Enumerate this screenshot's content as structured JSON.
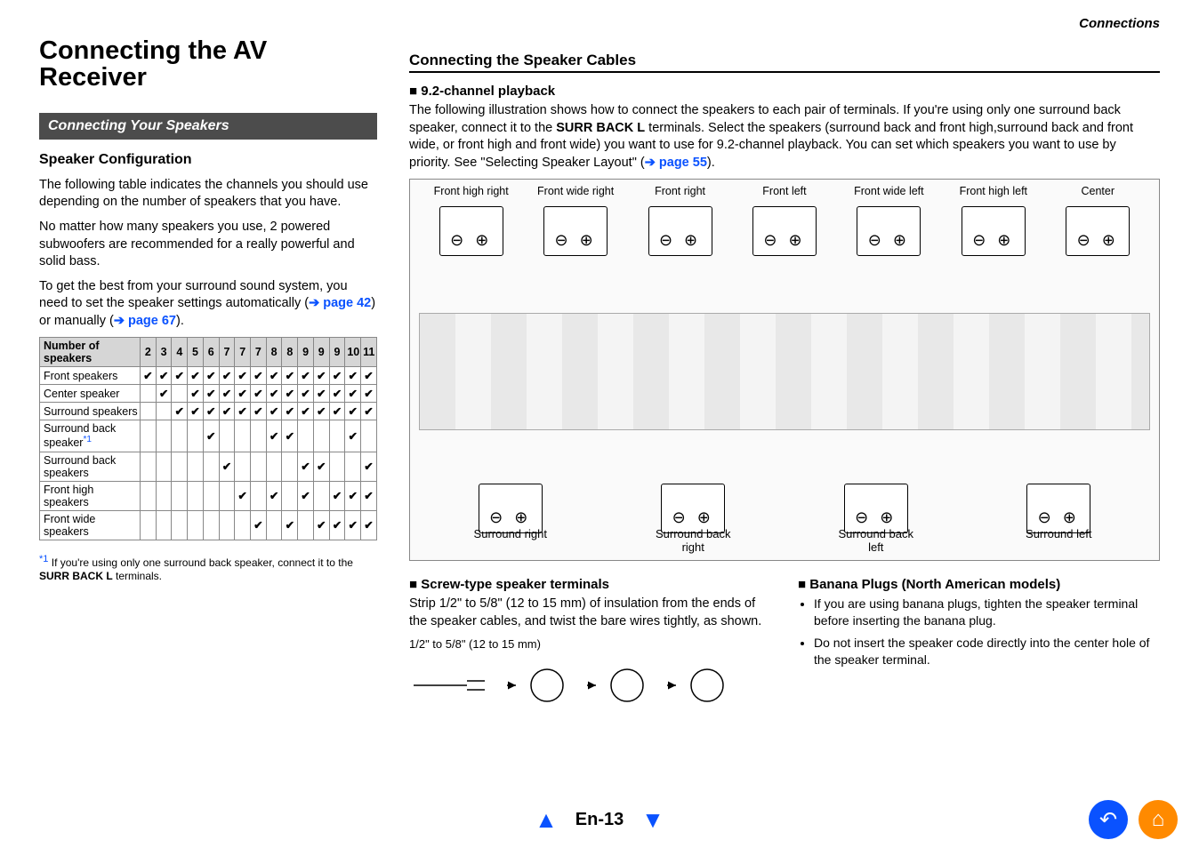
{
  "category": "Connections",
  "title": "Connecting the AV Receiver",
  "left": {
    "bar_heading": "Connecting Your Speakers",
    "sub_heading": "Speaker Configuration",
    "para1": "The following table indicates the channels you should use depending on the number of speakers that you have.",
    "para2": "No matter how many speakers you use, 2 powered subwoofers are recommended for a really powerful and solid bass.",
    "para3_a": "To get the best from your surround sound system, you need to set the speaker settings automatically (",
    "para3_link1": "page 42",
    "para3_b": ") or manually (",
    "para3_link2": "page 67",
    "para3_c": ").",
    "table_header": "Number of speakers",
    "cols": [
      "2",
      "3",
      "4",
      "5",
      "6",
      "7",
      "7",
      "7",
      "8",
      "8",
      "9",
      "9",
      "9",
      "10",
      "11"
    ],
    "rows": [
      {
        "label": "Front speakers",
        "c": [
          1,
          1,
          1,
          1,
          1,
          1,
          1,
          1,
          1,
          1,
          1,
          1,
          1,
          1,
          1
        ]
      },
      {
        "label": "Center speaker",
        "c": [
          0,
          1,
          0,
          1,
          1,
          1,
          1,
          1,
          1,
          1,
          1,
          1,
          1,
          1,
          1
        ]
      },
      {
        "label": "Surround speakers",
        "c": [
          0,
          0,
          1,
          1,
          1,
          1,
          1,
          1,
          1,
          1,
          1,
          1,
          1,
          1,
          1
        ]
      },
      {
        "label": "Surround back speaker",
        "sup": "*1",
        "c": [
          0,
          0,
          0,
          0,
          1,
          0,
          0,
          0,
          1,
          1,
          0,
          0,
          0,
          1,
          0
        ]
      },
      {
        "label": "Surround back speakers",
        "c": [
          0,
          0,
          0,
          0,
          0,
          1,
          0,
          0,
          0,
          0,
          1,
          1,
          0,
          0,
          1
        ]
      },
      {
        "label": "Front high speakers",
        "c": [
          0,
          0,
          0,
          0,
          0,
          0,
          1,
          0,
          1,
          0,
          1,
          0,
          1,
          1,
          1
        ]
      },
      {
        "label": "Front wide speakers",
        "c": [
          0,
          0,
          0,
          0,
          0,
          0,
          0,
          1,
          0,
          1,
          0,
          1,
          1,
          1,
          1
        ]
      }
    ],
    "footnote_mark": "*1",
    "footnote_text": "If you're using only one surround back speaker, connect it to the ",
    "footnote_bold": "SURR BACK L",
    "footnote_text2": " terminals."
  },
  "right": {
    "section_heading": "Connecting the Speaker Cables",
    "head1": "9.2-channel playback",
    "para_a": "The following illustration shows how to connect the speakers to each pair of terminals. If you're using only one surround back speaker, connect it to the ",
    "para_bold": "SURR BACK L",
    "para_b": " terminals. Select the speakers (surround back and front high,surround back and front wide, or front high and front wide) you want to use for 9.2-channel playback. You can set which speakers you want to use by priority. See \"Selecting Speaker Layout\" (",
    "para_link": "page 55",
    "para_c": ").",
    "diagram_top": [
      "Front high right",
      "Front wide right",
      "Front right",
      "Front left",
      "Front wide left",
      "Front high left",
      "Center"
    ],
    "diagram_bot": [
      "Surround right",
      "Surround back right",
      "Surround back left",
      "Surround left"
    ],
    "screw_head": "Screw-type speaker terminals",
    "screw_text": "Strip 1/2\" to 5/8\" (12 to 15 mm) of insulation from the ends of the speaker cables, and twist the bare wires tightly, as shown.",
    "strip_label": "1/2\" to 5/8\" (12 to 15 mm)",
    "banana_head": "Banana Plugs (North American models)",
    "banana_b1": "If you are using banana plugs, tighten the speaker terminal before inserting the banana plug.",
    "banana_b2": "Do not insert the speaker code directly into the center hole of the speaker terminal."
  },
  "footer": {
    "page": "En-13"
  }
}
